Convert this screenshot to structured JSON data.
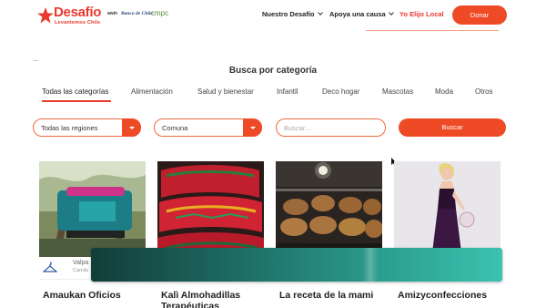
{
  "header": {
    "logo_title": "Desafío",
    "logo_subtitle": "Levantemos Chile",
    "partners": [
      "awin",
      "Banco de Chile",
      "cmpc"
    ],
    "nav": [
      {
        "label": "Nuestro Desafío"
      },
      {
        "label": "Apoya una causa"
      },
      {
        "label": "Yo Elijo Local"
      }
    ],
    "donate_label": "Donar"
  },
  "category_section": {
    "title": "Busca por categoría",
    "categories": [
      {
        "label": "Todas las categorías",
        "active": true
      },
      {
        "label": "Alimentación"
      },
      {
        "label": "Salud y bienestar"
      },
      {
        "label": "Infantil"
      },
      {
        "label": "Deco hogar"
      },
      {
        "label": "Mascotas"
      },
      {
        "label": "Moda"
      },
      {
        "label": "Otros"
      }
    ]
  },
  "filters": {
    "region_value": "Todas las regiones",
    "comuna_value": "Comuna",
    "search_placeholder": "Buscar...",
    "search_button": "Buscar"
  },
  "cards": [
    {
      "name": "Amaukan Oficios",
      "location": "Valpa",
      "category": "Camila",
      "icon": "hanger-icon"
    },
    {
      "name": "Kalì Almohadillas Terapéuticas"
    },
    {
      "name": "La receta de la mami"
    },
    {
      "name": "Amizyconfecciones"
    }
  ],
  "colors": {
    "accent": "#ee4a25",
    "banner_teal": "#2da394"
  }
}
